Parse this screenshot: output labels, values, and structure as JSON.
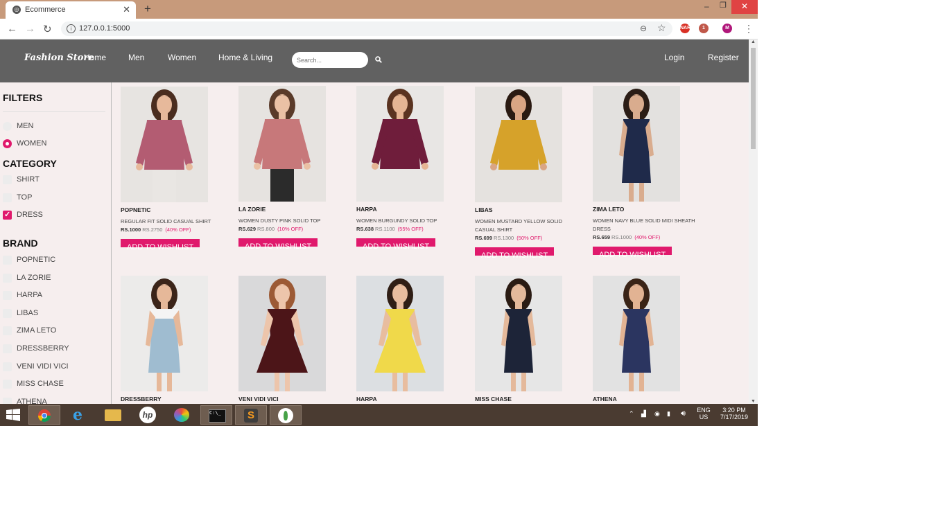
{
  "browser": {
    "tab_title": "Ecommerce",
    "new_tab": "+",
    "tab_close": "✕",
    "url": "127.0.0.1:5000",
    "back": "←",
    "forward": "→",
    "reload": "↻",
    "info": "i",
    "zoom": "⊖",
    "star": "☆",
    "menu": "⋮",
    "window_min": "–",
    "window_max": "❐",
    "window_close": "✕",
    "extensions": [
      {
        "name": "red-extension-icon",
        "color": "#d93025",
        "text": "NAR"
      },
      {
        "name": "puzzle-extension-icon",
        "color": "#c0584a",
        "text": "1"
      },
      {
        "name": "profile-avatar-icon",
        "color": "#b0177a",
        "text": "M"
      }
    ]
  },
  "site": {
    "brand": "Fashion Store",
    "nav": [
      "Home",
      "Men",
      "Women",
      "Home & Living"
    ],
    "search_placeholder": "Search...",
    "auth": {
      "login": "Login",
      "register": "Register"
    }
  },
  "filters": {
    "title": "FILTERS",
    "gender": [
      {
        "label": "MEN",
        "checked": false
      },
      {
        "label": "WOMEN",
        "checked": true
      }
    ],
    "category_title": "CATEGORY",
    "category": [
      {
        "label": "SHIRT",
        "checked": false
      },
      {
        "label": "TOP",
        "checked": false
      },
      {
        "label": "DRESS",
        "checked": true
      }
    ],
    "brand_title": "BRAND",
    "brands": [
      "POPNETIC",
      "LA ZORIE",
      "HARPA",
      "LIBAS",
      "ZIMA LETO",
      "DRESSBERRY",
      "VENI VIDI VICI",
      "MISS CHASE",
      "ATHENA"
    ]
  },
  "wishlist_label": "ADD TO WISHLIST",
  "products": [
    {
      "brand": "POPNETIC",
      "name": "REGULAR FIT SOLID CASUAL SHIRT",
      "price": "RS.1000",
      "mrp": "RS.2750",
      "off": "(40% OFF)",
      "bg": "#e7e4e1",
      "color": "#b35c72",
      "skin": "#e7b99b",
      "hair": "#4a2d1f",
      "bottom": "#e9e6e3",
      "style": "shirt"
    },
    {
      "brand": "LA ZORIE",
      "name": "WOMEN DUSTY PINK SOLID TOP",
      "price": "RS.629",
      "mrp": "RS.800",
      "off": "(10% OFF)",
      "bg": "#e6e3e0",
      "color": "#c7787a",
      "skin": "#eac1a5",
      "hair": "#5a3b2a",
      "bottom": "#2b2b2b",
      "style": "top"
    },
    {
      "brand": "HARPA",
      "name": "WOMEN BURGUNDY SOLID TOP",
      "price": "RS.638",
      "mrp": "RS.1100",
      "off": "(55% OFF)",
      "bg": "#e8e6e4",
      "color": "#6f1d3b",
      "skin": "#e5b594",
      "hair": "#5a3320",
      "bottom": "#e8e6e4",
      "style": "top"
    },
    {
      "brand": "LIBAS",
      "name": "WOMEN MUSTARD YELLOW SOLID CASUAL SHIRT",
      "price": "RS.699",
      "mrp": "RS.1300",
      "off": "(50% OFF)",
      "bg": "#e5e2df",
      "color": "#d6a22a",
      "skin": "#d9a584",
      "hair": "#2a1a12",
      "bottom": "#e5e2df",
      "style": "shirt"
    },
    {
      "brand": "ZIMA LETO",
      "name": "WOMEN NAVY BLUE SOLID MIDI SHEATH DRESS",
      "price": "RS.659",
      "mrp": "RS.1000",
      "off": "(40% OFF)",
      "bg": "#e3e1df",
      "color": "#1f2a4a",
      "skin": "#d9ac8e",
      "hair": "#2b1d16",
      "bottom": "#1f2a4a",
      "style": "dress"
    },
    {
      "brand": "DRESSBERRY",
      "name": "",
      "price": "",
      "mrp": "",
      "off": "",
      "bg": "#ecebea",
      "color": "#9fbcd0",
      "skin": "#e6b899",
      "hair": "#3b2419",
      "bottom": "#9fbcd0",
      "style": "dungaree"
    },
    {
      "brand": "VENI VIDI VICI",
      "name": "",
      "price": "",
      "mrp": "",
      "off": "",
      "bg": "#d9d9da",
      "color": "#4c1518",
      "skin": "#edc5ab",
      "hair": "#9c5a35",
      "bottom": "#4c1518",
      "style": "flare"
    },
    {
      "brand": "HARPA",
      "name": "",
      "price": "",
      "mrp": "",
      "off": "",
      "bg": "#dcdfe2",
      "color": "#f0d94a",
      "skin": "#e8bd9f",
      "hair": "#2f1e15",
      "bottom": "#f0d94a",
      "style": "flare"
    },
    {
      "brand": "MISS CHASE",
      "name": "",
      "price": "",
      "mrp": "",
      "off": "",
      "bg": "#e6e6e6",
      "color": "#1d2438",
      "skin": "#e4b99b",
      "hair": "#2a1b13",
      "bottom": "#1d2438",
      "style": "dress"
    },
    {
      "brand": "ATHENA",
      "name": "",
      "price": "",
      "mrp": "",
      "off": "",
      "bg": "#e2e2e2",
      "color": "#2b3560",
      "skin": "#e2b393",
      "hair": "#3a2417",
      "bottom": "#2b3560",
      "style": "dress"
    }
  ],
  "taskbar": {
    "apps": [
      "windows-start-icon",
      "chrome-icon",
      "internet-explorer-icon",
      "file-explorer-icon",
      "hp-icon",
      "paint-icon",
      "cmd-icon",
      "sublime-text-icon",
      "mongodb-icon"
    ],
    "lang": "ENG",
    "region": "US",
    "time": "3:20 PM",
    "date": "7/17/2019"
  }
}
